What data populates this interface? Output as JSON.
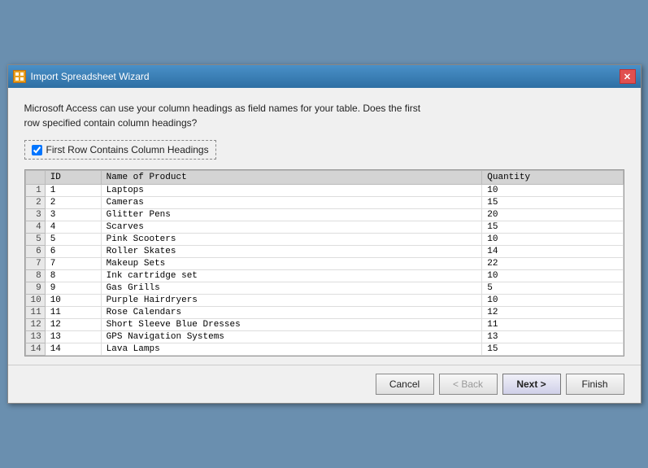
{
  "window": {
    "title": "Import Spreadsheet Wizard",
    "close_label": "✕"
  },
  "description": {
    "text": "Microsoft Access can use your column headings as field names for your table. Does the first\nrow specified contain column headings?"
  },
  "checkbox": {
    "label": "First Row Contains Column Headings",
    "checked": true
  },
  "table": {
    "columns": [
      {
        "id": "rownum",
        "label": ""
      },
      {
        "id": "id",
        "label": "ID"
      },
      {
        "id": "name",
        "label": "Name of Product"
      },
      {
        "id": "qty",
        "label": "Quantity"
      }
    ],
    "rows": [
      {
        "rownum": "1",
        "id": "1",
        "name": "Laptops",
        "qty": "10"
      },
      {
        "rownum": "2",
        "id": "2",
        "name": "Cameras",
        "qty": "15"
      },
      {
        "rownum": "3",
        "id": "3",
        "name": "Glitter Pens",
        "qty": "20"
      },
      {
        "rownum": "4",
        "id": "4",
        "name": "Scarves",
        "qty": "15"
      },
      {
        "rownum": "5",
        "id": "5",
        "name": "Pink Scooters",
        "qty": "10"
      },
      {
        "rownum": "6",
        "id": "6",
        "name": "Roller Skates",
        "qty": "14"
      },
      {
        "rownum": "7",
        "id": "7",
        "name": "Makeup Sets",
        "qty": "22"
      },
      {
        "rownum": "8",
        "id": "8",
        "name": "Ink cartridge set",
        "qty": "10"
      },
      {
        "rownum": "9",
        "id": "9",
        "name": "Gas Grills",
        "qty": "5"
      },
      {
        "rownum": "10",
        "id": "10",
        "name": "Purple Hairdryers",
        "qty": "10"
      },
      {
        "rownum": "11",
        "id": "11",
        "name": "Rose Calendars",
        "qty": "12"
      },
      {
        "rownum": "12",
        "id": "12",
        "name": "Short Sleeve Blue Dresses",
        "qty": "11"
      },
      {
        "rownum": "13",
        "id": "13",
        "name": "GPS Navigation Systems",
        "qty": "13"
      },
      {
        "rownum": "14",
        "id": "14",
        "name": "Lava Lamps",
        "qty": "15"
      }
    ]
  },
  "buttons": {
    "cancel": "Cancel",
    "back": "< Back",
    "next": "Next >",
    "finish": "Finish"
  }
}
